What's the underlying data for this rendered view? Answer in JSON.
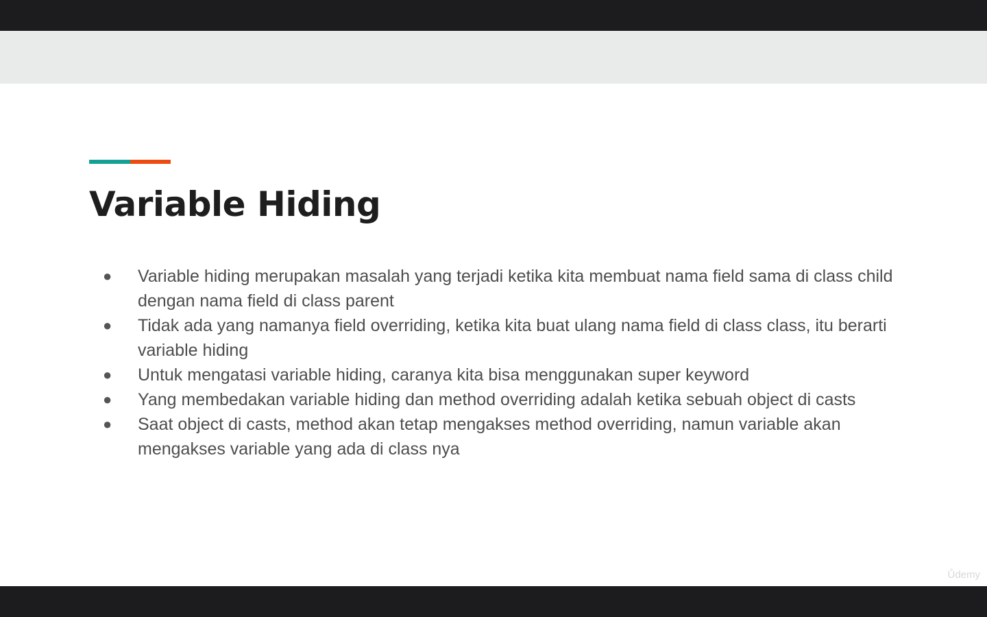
{
  "colors": {
    "accent_teal": "#14a095",
    "accent_orange": "#ee4b12",
    "title": "#1e1e1e",
    "body_text": "#4d4d4d"
  },
  "slide": {
    "title": "Variable Hiding",
    "bullet_glyph": "●",
    "bullets": [
      "Variable hiding merupakan masalah yang terjadi ketika kita membuat nama field sama di class child dengan nama field di class parent",
      "Tidak ada yang namanya field overriding, ketika kita buat ulang nama field di class class, itu berarti variable hiding",
      "Untuk mengatasi variable hiding, caranya kita bisa menggunakan super keyword",
      "Yang membedakan variable hiding dan method overriding adalah ketika sebuah object di casts",
      "Saat object di casts, method akan tetap mengakses method overriding, namun variable akan mengakses variable yang ada di class nya"
    ]
  },
  "watermark": "Ůdemy"
}
